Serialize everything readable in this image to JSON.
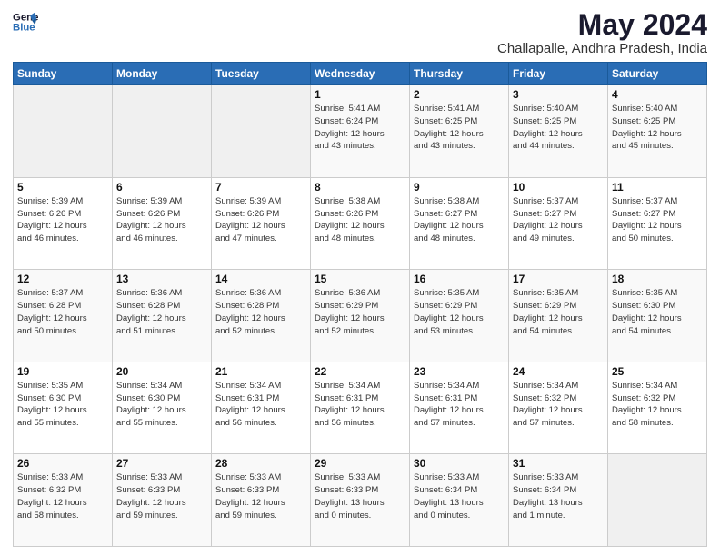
{
  "header": {
    "logo_line1": "General",
    "logo_line2": "Blue",
    "title": "May 2024",
    "subtitle": "Challapalle, Andhra Pradesh, India"
  },
  "weekdays": [
    "Sunday",
    "Monday",
    "Tuesday",
    "Wednesday",
    "Thursday",
    "Friday",
    "Saturday"
  ],
  "weeks": [
    [
      {
        "day": "",
        "info": ""
      },
      {
        "day": "",
        "info": ""
      },
      {
        "day": "",
        "info": ""
      },
      {
        "day": "1",
        "info": "Sunrise: 5:41 AM\nSunset: 6:24 PM\nDaylight: 12 hours\nand 43 minutes."
      },
      {
        "day": "2",
        "info": "Sunrise: 5:41 AM\nSunset: 6:25 PM\nDaylight: 12 hours\nand 43 minutes."
      },
      {
        "day": "3",
        "info": "Sunrise: 5:40 AM\nSunset: 6:25 PM\nDaylight: 12 hours\nand 44 minutes."
      },
      {
        "day": "4",
        "info": "Sunrise: 5:40 AM\nSunset: 6:25 PM\nDaylight: 12 hours\nand 45 minutes."
      }
    ],
    [
      {
        "day": "5",
        "info": "Sunrise: 5:39 AM\nSunset: 6:26 PM\nDaylight: 12 hours\nand 46 minutes."
      },
      {
        "day": "6",
        "info": "Sunrise: 5:39 AM\nSunset: 6:26 PM\nDaylight: 12 hours\nand 46 minutes."
      },
      {
        "day": "7",
        "info": "Sunrise: 5:39 AM\nSunset: 6:26 PM\nDaylight: 12 hours\nand 47 minutes."
      },
      {
        "day": "8",
        "info": "Sunrise: 5:38 AM\nSunset: 6:26 PM\nDaylight: 12 hours\nand 48 minutes."
      },
      {
        "day": "9",
        "info": "Sunrise: 5:38 AM\nSunset: 6:27 PM\nDaylight: 12 hours\nand 48 minutes."
      },
      {
        "day": "10",
        "info": "Sunrise: 5:37 AM\nSunset: 6:27 PM\nDaylight: 12 hours\nand 49 minutes."
      },
      {
        "day": "11",
        "info": "Sunrise: 5:37 AM\nSunset: 6:27 PM\nDaylight: 12 hours\nand 50 minutes."
      }
    ],
    [
      {
        "day": "12",
        "info": "Sunrise: 5:37 AM\nSunset: 6:28 PM\nDaylight: 12 hours\nand 50 minutes."
      },
      {
        "day": "13",
        "info": "Sunrise: 5:36 AM\nSunset: 6:28 PM\nDaylight: 12 hours\nand 51 minutes."
      },
      {
        "day": "14",
        "info": "Sunrise: 5:36 AM\nSunset: 6:28 PM\nDaylight: 12 hours\nand 52 minutes."
      },
      {
        "day": "15",
        "info": "Sunrise: 5:36 AM\nSunset: 6:29 PM\nDaylight: 12 hours\nand 52 minutes."
      },
      {
        "day": "16",
        "info": "Sunrise: 5:35 AM\nSunset: 6:29 PM\nDaylight: 12 hours\nand 53 minutes."
      },
      {
        "day": "17",
        "info": "Sunrise: 5:35 AM\nSunset: 6:29 PM\nDaylight: 12 hours\nand 54 minutes."
      },
      {
        "day": "18",
        "info": "Sunrise: 5:35 AM\nSunset: 6:30 PM\nDaylight: 12 hours\nand 54 minutes."
      }
    ],
    [
      {
        "day": "19",
        "info": "Sunrise: 5:35 AM\nSunset: 6:30 PM\nDaylight: 12 hours\nand 55 minutes."
      },
      {
        "day": "20",
        "info": "Sunrise: 5:34 AM\nSunset: 6:30 PM\nDaylight: 12 hours\nand 55 minutes."
      },
      {
        "day": "21",
        "info": "Sunrise: 5:34 AM\nSunset: 6:31 PM\nDaylight: 12 hours\nand 56 minutes."
      },
      {
        "day": "22",
        "info": "Sunrise: 5:34 AM\nSunset: 6:31 PM\nDaylight: 12 hours\nand 56 minutes."
      },
      {
        "day": "23",
        "info": "Sunrise: 5:34 AM\nSunset: 6:31 PM\nDaylight: 12 hours\nand 57 minutes."
      },
      {
        "day": "24",
        "info": "Sunrise: 5:34 AM\nSunset: 6:32 PM\nDaylight: 12 hours\nand 57 minutes."
      },
      {
        "day": "25",
        "info": "Sunrise: 5:34 AM\nSunset: 6:32 PM\nDaylight: 12 hours\nand 58 minutes."
      }
    ],
    [
      {
        "day": "26",
        "info": "Sunrise: 5:33 AM\nSunset: 6:32 PM\nDaylight: 12 hours\nand 58 minutes."
      },
      {
        "day": "27",
        "info": "Sunrise: 5:33 AM\nSunset: 6:33 PM\nDaylight: 12 hours\nand 59 minutes."
      },
      {
        "day": "28",
        "info": "Sunrise: 5:33 AM\nSunset: 6:33 PM\nDaylight: 12 hours\nand 59 minutes."
      },
      {
        "day": "29",
        "info": "Sunrise: 5:33 AM\nSunset: 6:33 PM\nDaylight: 13 hours\nand 0 minutes."
      },
      {
        "day": "30",
        "info": "Sunrise: 5:33 AM\nSunset: 6:34 PM\nDaylight: 13 hours\nand 0 minutes."
      },
      {
        "day": "31",
        "info": "Sunrise: 5:33 AM\nSunset: 6:34 PM\nDaylight: 13 hours\nand 1 minute."
      },
      {
        "day": "",
        "info": ""
      }
    ]
  ]
}
